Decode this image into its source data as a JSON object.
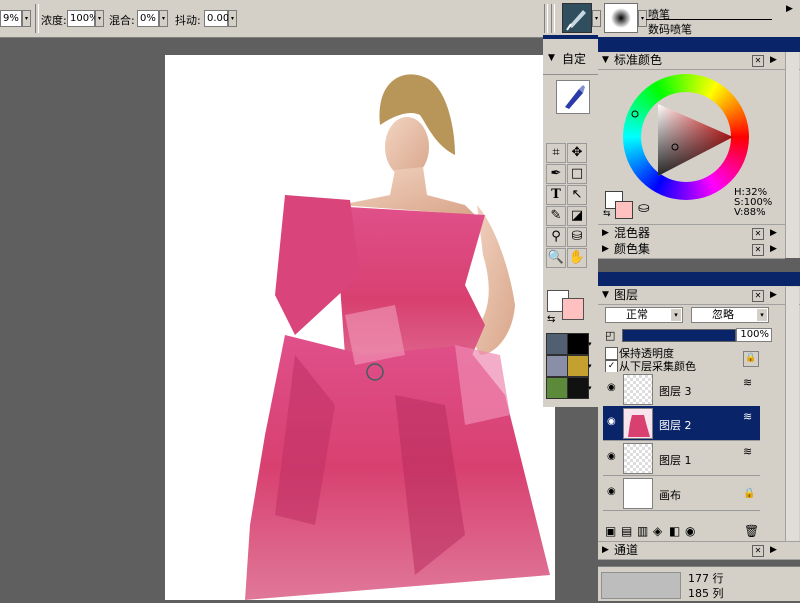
{
  "toolbar": {
    "first_value": "9%",
    "density_label": "浓度:",
    "density_value": "100%",
    "mix_label": "混合:",
    "mix_value": "0%",
    "jitter_label": "抖动:",
    "jitter_value": "0.00",
    "brush_category": "喷笔",
    "brush_variant": "数码喷笔"
  },
  "custom_panel": {
    "title": "自定"
  },
  "color_panel": {
    "title": "标准颜色",
    "h": "H:32%",
    "s": "S:100%",
    "v": "V:88%",
    "mixer": "混色器",
    "color_set": "颜色集"
  },
  "layers_panel": {
    "title": "图层",
    "blend_mode": "正常",
    "composite": "忽略",
    "opacity": "100%",
    "preserve_transparency": "保持透明度",
    "pick_up_underlying": "从下层采集颜色",
    "layers": [
      {
        "name": "图层 3",
        "selected": false
      },
      {
        "name": "图层 2",
        "selected": true
      },
      {
        "name": "图层 1",
        "selected": false
      },
      {
        "name": "画布",
        "selected": false
      }
    ],
    "channels": "通道"
  },
  "status": {
    "rows": "177 行",
    "cols": "185 列"
  },
  "colors": {
    "accent": "#0a246a",
    "panel": "#d4d0c8",
    "dress": "#d84a7d"
  }
}
